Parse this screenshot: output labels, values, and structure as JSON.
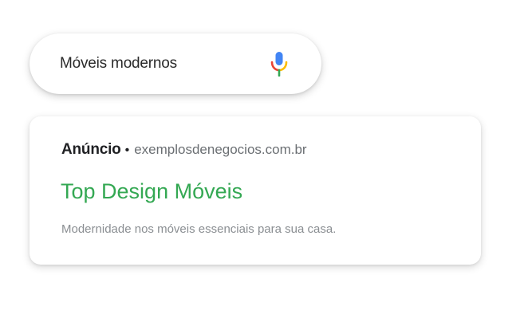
{
  "search": {
    "query": "Móveis modernos",
    "mic_icon": "microphone-icon"
  },
  "ad": {
    "label": "Anúncio",
    "separator": "•",
    "url": "exemplosdenegocios.com.br",
    "title": "Top Design Móveis",
    "description": "Modernidade nos móveis essenciais para sua casa."
  },
  "colors": {
    "title_green": "#34a853",
    "mic_blue": "#4285f4",
    "mic_red": "#ea4335",
    "mic_yellow": "#fbbc05",
    "mic_green": "#34a853"
  }
}
